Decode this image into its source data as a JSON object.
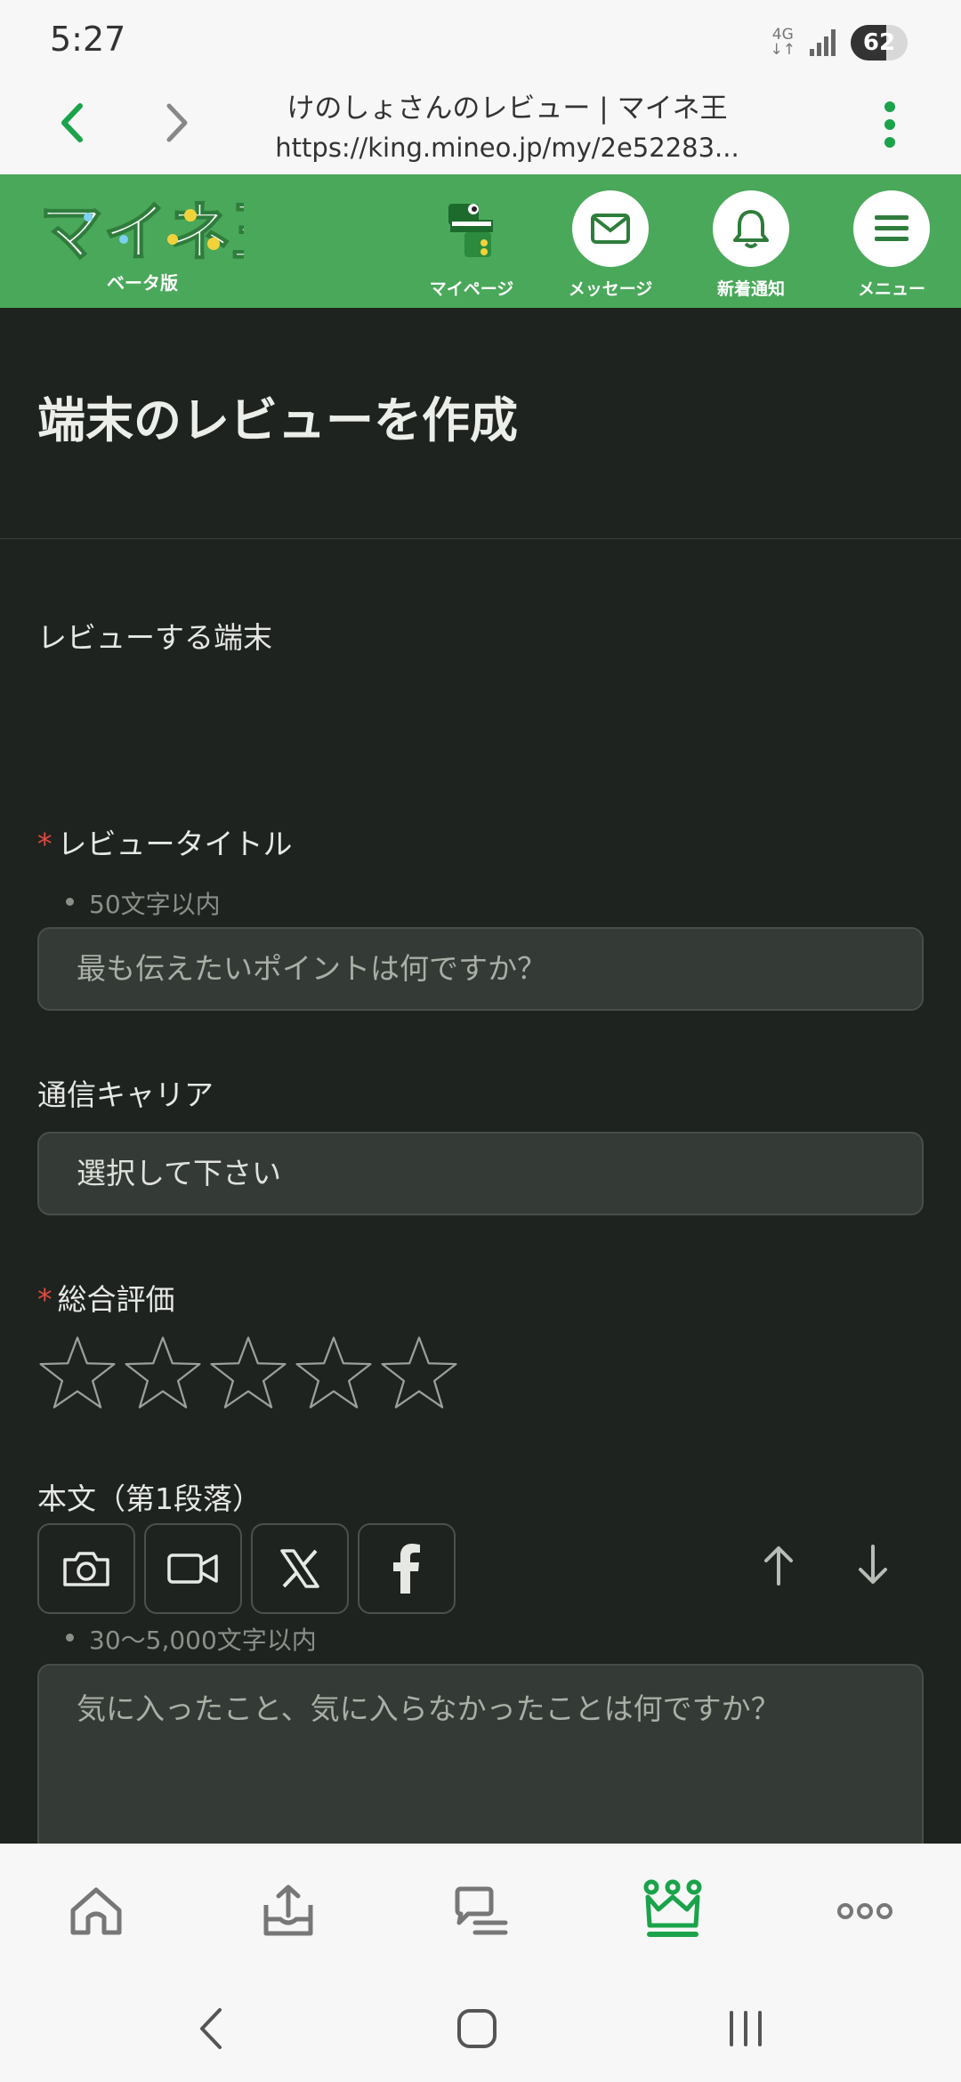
{
  "status_bar": {
    "time": "5:27",
    "network": "4G",
    "battery": "62",
    "battery_level": 0.62
  },
  "browser": {
    "page_title": "けのしょさんのレビュー | マイネ王",
    "url": "https://king.mineo.jp/my/2e52283..."
  },
  "site_header": {
    "logo_text": "マイネ王",
    "beta_label": "ベータ版",
    "items": [
      {
        "label": "マイページ",
        "icon": "crocodile-mascot-icon"
      },
      {
        "label": "メッセージ",
        "icon": "mail-icon"
      },
      {
        "label": "新着通知",
        "icon": "bell-icon"
      },
      {
        "label": "メニュー",
        "icon": "hamburger-icon"
      }
    ]
  },
  "page": {
    "title": "端末のレビューを作成"
  },
  "form": {
    "device": {
      "label": "レビューする端末"
    },
    "review_title": {
      "required_mark": "*",
      "label": "レビュータイトル",
      "hint": "50文字以内",
      "placeholder": "最も伝えたいポイントは何ですか？"
    },
    "carrier": {
      "label": "通信キャリア",
      "value": "選択して下さい"
    },
    "rating": {
      "required_mark": "*",
      "label": "総合評価",
      "max_stars": 5,
      "value": 0
    },
    "body": {
      "label": "本文（第1段落）",
      "tools": [
        "camera-icon",
        "video-icon",
        "x-logo-icon",
        "facebook-icon"
      ],
      "hint": "30〜5,000文字以内",
      "placeholder": "気に入ったこと、気に入らなかったことは何ですか？"
    }
  },
  "bottom_nav": {
    "items": [
      "home-icon",
      "upload-icon",
      "chat-icon",
      "crown-icon",
      "more-icon"
    ],
    "active_index": 3
  },
  "colors": {
    "brand_green": "#4aa85a",
    "accent_green": "#1aa34a",
    "background": "#1f2320",
    "required": "#e04a3f"
  }
}
